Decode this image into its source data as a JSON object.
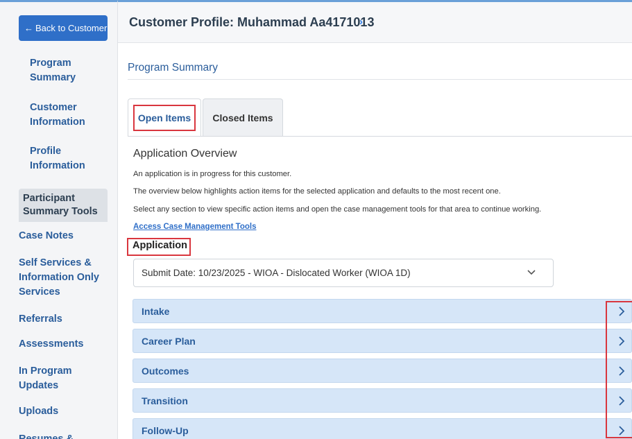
{
  "sidebar": {
    "back_button": {
      "arrow": "←",
      "label": "Back to Customer"
    },
    "items": [
      {
        "label": "Program Summary"
      },
      {
        "label": "Customer Information"
      },
      {
        "label": "Profile Information"
      }
    ],
    "tools_heading": "Participant Summary Tools",
    "tools": [
      {
        "label": "Case Notes"
      },
      {
        "label": "Self Services & Information Only Services"
      },
      {
        "label": "Referrals"
      },
      {
        "label": "Assessments"
      },
      {
        "label": "In Program Updates"
      },
      {
        "label": "Uploads"
      },
      {
        "label": "Resumes &"
      }
    ]
  },
  "header": {
    "title": "Customer Profile: Muhammad Aa4171013",
    "chevron": "›"
  },
  "main": {
    "section_title": "Program Summary",
    "tabs": [
      {
        "label": "Open Items",
        "active": true
      },
      {
        "label": "Closed Items",
        "active": false
      }
    ],
    "overview": {
      "title": "Application Overview",
      "lines": [
        "An application is in progress for this customer.",
        "The overview below highlights action items for the selected application and defaults to the most recent one.",
        "Select any section to view specific action items and open the case management tools for that area to continue working."
      ],
      "link": "Access Case Management Tools"
    },
    "application_label": "Application",
    "application_select": {
      "value": "Submit Date: 10/23/2025 - WIOA - Dislocated Worker (WIOA 1D)",
      "icon": "chevron-down-icon"
    },
    "sections": [
      {
        "label": "Intake"
      },
      {
        "label": "Career Plan"
      },
      {
        "label": "Outcomes"
      },
      {
        "label": "Transition"
      },
      {
        "label": "Follow-Up"
      }
    ]
  },
  "colors": {
    "accent": "#2f6fc8",
    "highlight": "#d9363e",
    "accordion_bg": "#d6e6f8"
  }
}
